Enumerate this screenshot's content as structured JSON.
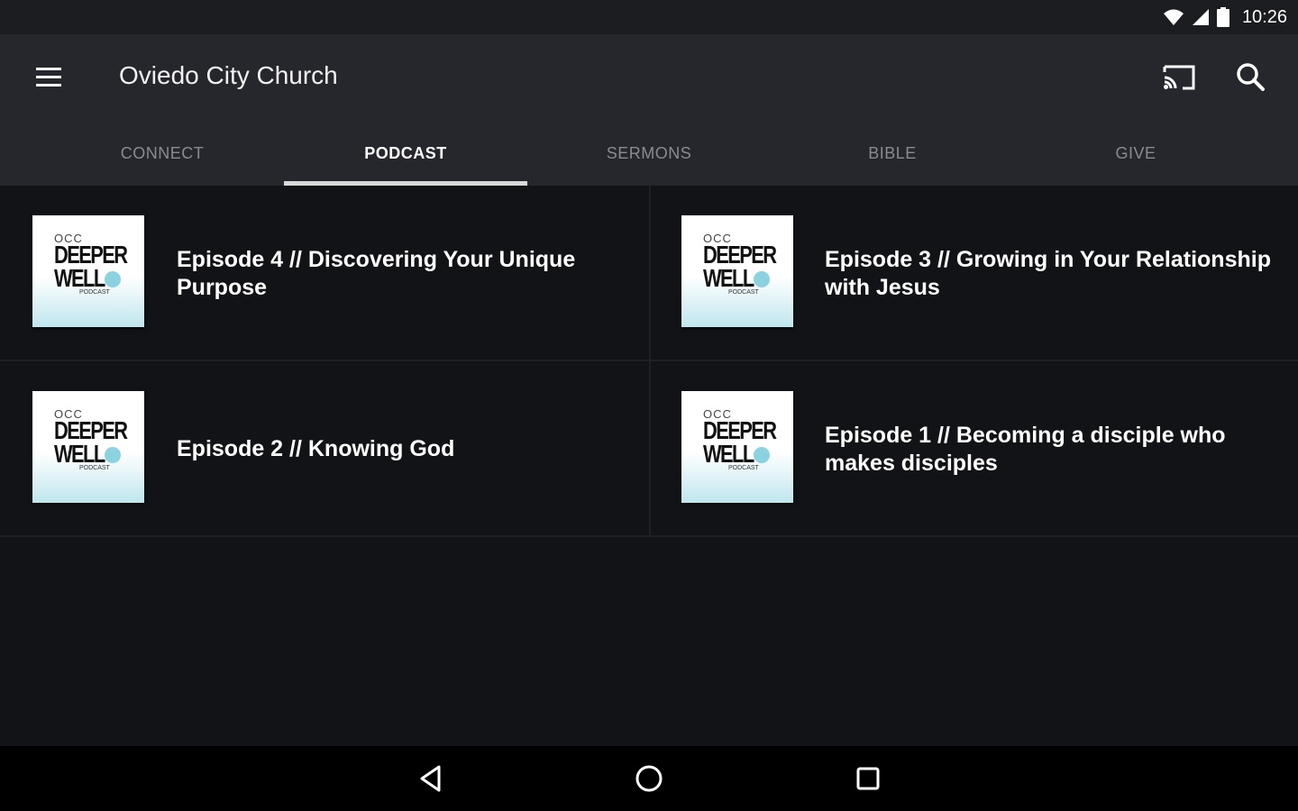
{
  "status_bar": {
    "time": "10:26",
    "icons": [
      "wifi-icon",
      "cell-signal-icon",
      "battery-icon"
    ]
  },
  "app_bar": {
    "title": "Oviedo City Church",
    "icons": [
      "menu-icon",
      "cast-icon",
      "search-icon"
    ]
  },
  "tabs": [
    {
      "label": "CONNECT",
      "active": false
    },
    {
      "label": "PODCAST",
      "active": true
    },
    {
      "label": "SERMONS",
      "active": false
    },
    {
      "label": "BIBLE",
      "active": false
    },
    {
      "label": "GIVE",
      "active": false
    }
  ],
  "thumbnail": {
    "occ": "OCC",
    "line1": "DEEPER",
    "line2": "WELL",
    "sub": "PODCAST"
  },
  "episodes": [
    {
      "title": "Episode 4 // Discovering Your Unique Purpose"
    },
    {
      "title": "Episode 3 // Growing in Your Relationship with Jesus"
    },
    {
      "title": "Episode 2 // Knowing God"
    },
    {
      "title": "Episode 1 // Becoming a disciple who makes disciples"
    }
  ],
  "nav_bar": {
    "icons": [
      "back-icon",
      "home-icon",
      "recents-icon"
    ]
  },
  "colors": {
    "background": "#121316",
    "app_bar": "#26272c",
    "status_bar": "#1c1d21",
    "tab_inactive": "#8a8b90",
    "tab_indicator": "#d8d8d8"
  }
}
